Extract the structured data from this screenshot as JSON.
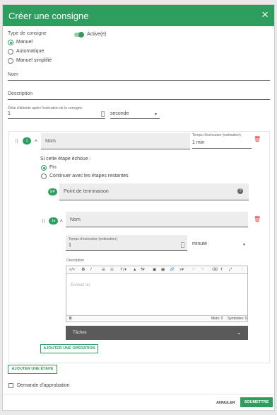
{
  "dialog": {
    "title": "Créer une consigne",
    "close_icon": "×"
  },
  "type_consigne": {
    "label": "Type de consigne",
    "options": [
      "Manuel",
      "Automatique",
      "Manuel simplifié"
    ],
    "selected": "Manuel"
  },
  "active_toggle": {
    "label": "Active(e)",
    "checked": true
  },
  "nom_field": {
    "label": "Nom",
    "value": ""
  },
  "description_field": {
    "label": "Description",
    "value": ""
  },
  "delai": {
    "label": "Délai d'atteinte après l'exécution de la consigne",
    "value": "1",
    "unit": "seconde"
  },
  "step1": {
    "badge": "1",
    "nom_placeholder": "Nom",
    "exec_time_label": "Temps d'exécution (estimation)",
    "exec_time_value": "1 min",
    "on_fail_label": "Si cette étape échoue :",
    "fail_options": [
      "Fin",
      "Continuer avec les étapes restantes"
    ],
    "fail_selected": "Fin",
    "end_point_badge": "EP",
    "end_point_placeholder": "Point de terminaison",
    "help_icon": "?"
  },
  "op1": {
    "badge": "1a",
    "nom_placeholder": "Nom",
    "exec_time_label": "Temps d'exécution (estimation)",
    "exec_time_value": "1",
    "unit": "minute",
    "description_label": "Description",
    "editor_placeholder": "Écrivez ici",
    "status_path": "B",
    "words": "Mots: 0",
    "symbols": "Symboles: 0",
    "taches_label": "Tâches"
  },
  "toolbar": {
    "code": "</>",
    "bold": "B",
    "italic": "I",
    "bullets": "☰",
    "numbered": "☷",
    "font_size": "T↕▾",
    "color": "▲",
    "paragraph": "¶▾",
    "image": "▣",
    "table": "▦",
    "link": "🔗",
    "align": "≡▾",
    "undo": "↶",
    "redo": "↷",
    "clear": "⌫",
    "format": "T",
    "fullscreen": "⤢",
    "more": "⋮"
  },
  "buttons": {
    "add_operation": "AJOUTER UNE OPÉRATION",
    "add_step": "AJOUTER UNE ÉTAPE",
    "cancel": "ANNULER",
    "submit": "SOUMETTRE"
  },
  "approval": {
    "label": "Demande d'approbation",
    "checked": false
  },
  "colors": {
    "primary": "#2e9e5e",
    "danger": "#e53935",
    "taches_bar": "#5a5a5a"
  },
  "icons": {
    "drag": "⠿",
    "chevron_up": "^",
    "chevron_down": "⌄",
    "trash": "🗑",
    "caret": "▾"
  }
}
